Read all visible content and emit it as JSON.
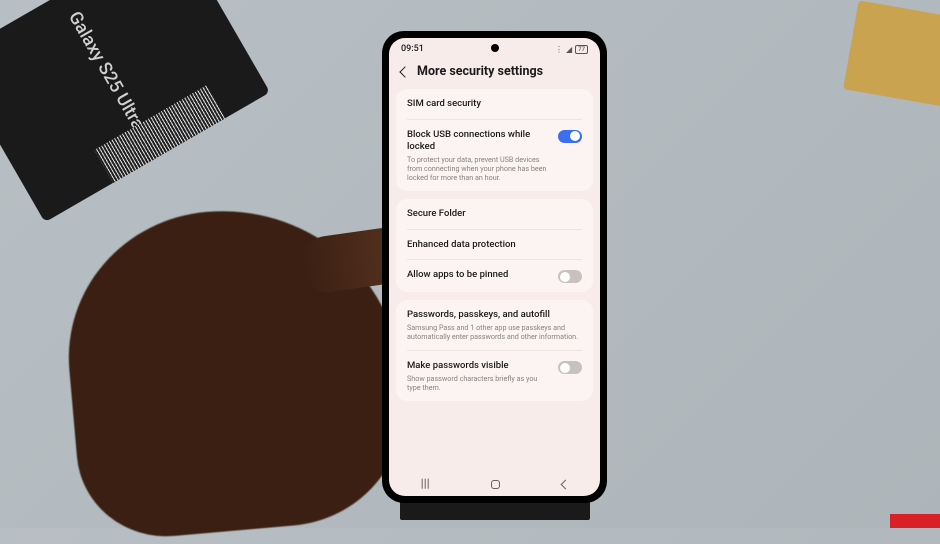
{
  "scene": {
    "box_label": "Galaxy S25 Ultra"
  },
  "status": {
    "time": "09:51",
    "battery": "77"
  },
  "header": {
    "title": "More security settings"
  },
  "group1": {
    "sim": {
      "title": "SIM card security"
    },
    "usb": {
      "title": "Block USB connections while locked",
      "desc": "To protect your data, prevent USB devices from connecting when your phone has been locked for more than an hour.",
      "on": true
    }
  },
  "group2": {
    "secure_folder": {
      "title": "Secure Folder"
    },
    "enhanced": {
      "title": "Enhanced data protection"
    },
    "pin": {
      "title": "Allow apps to be pinned",
      "on": false
    }
  },
  "group3": {
    "passwords": {
      "title": "Passwords, passkeys, and autofill",
      "desc": "Samsung Pass and 1 other app use passkeys and automatically enter passwords and other information."
    },
    "visible": {
      "title": "Make passwords visible",
      "desc": "Show password characters briefly as you type them.",
      "on": false
    }
  }
}
